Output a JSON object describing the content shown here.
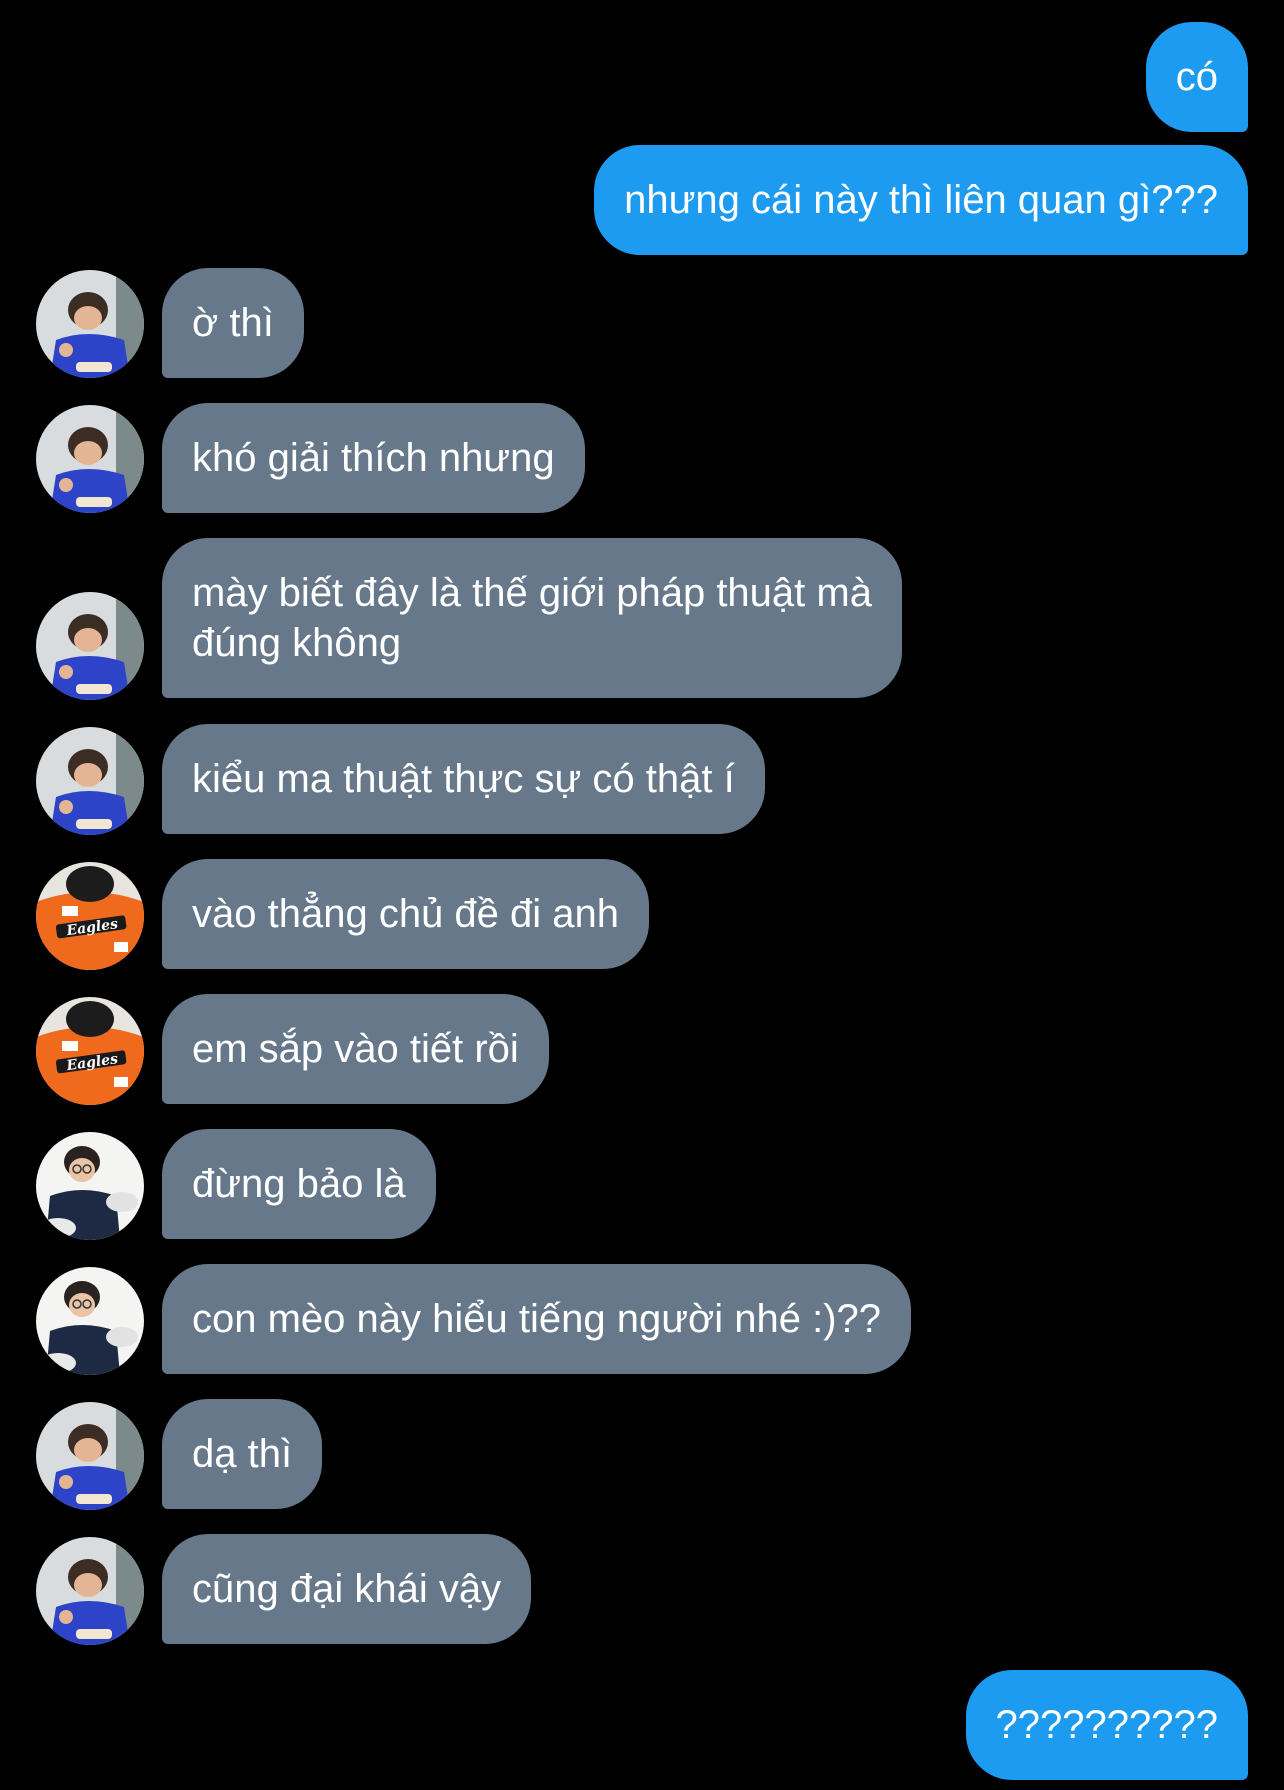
{
  "colors": {
    "background": "#000000",
    "outgoing_bubble": "#1d9bf0",
    "incoming_bubble": "#66788a",
    "text": "#ffffff"
  },
  "messages": [
    {
      "direction": "outgoing",
      "text": "có"
    },
    {
      "direction": "outgoing",
      "text": "nhưng cái này thì liên quan gì???"
    },
    {
      "direction": "incoming",
      "avatar": "avatar-blue-shirt-icon",
      "text": "ờ thì"
    },
    {
      "direction": "incoming",
      "avatar": "avatar-blue-shirt-icon",
      "text": "khó giải thích nhưng"
    },
    {
      "direction": "incoming",
      "avatar": "avatar-blue-shirt-icon",
      "text": "mày biết đây là thế giới pháp thuật mà\nđúng không"
    },
    {
      "direction": "incoming",
      "avatar": "avatar-blue-shirt-icon",
      "text": "kiểu ma thuật thực sự có thật í"
    },
    {
      "direction": "incoming",
      "avatar": "avatar-orange-jersey-icon",
      "text": "vào thẳng chủ đề đi anh"
    },
    {
      "direction": "incoming",
      "avatar": "avatar-orange-jersey-icon",
      "text": "em sắp vào tiết rồi"
    },
    {
      "direction": "incoming",
      "avatar": "avatar-navy-sweater-icon",
      "text": "đừng bảo là"
    },
    {
      "direction": "incoming",
      "avatar": "avatar-navy-sweater-icon",
      "text": "con mèo này hiểu tiếng người nhé :)??"
    },
    {
      "direction": "incoming",
      "avatar": "avatar-blue-shirt-icon",
      "text": "dạ thì"
    },
    {
      "direction": "incoming",
      "avatar": "avatar-blue-shirt-icon",
      "text": "cũng đại khái vậy"
    },
    {
      "direction": "outgoing",
      "text": "??????????"
    }
  ]
}
